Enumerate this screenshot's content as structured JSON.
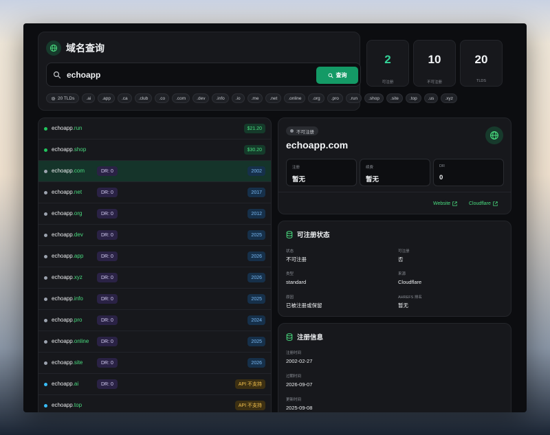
{
  "header": {
    "title": "域名查询",
    "search": {
      "value": "echoapp",
      "placeholder": ""
    },
    "query_button": "查询",
    "tld_count_label": "20 TLDs",
    "tlds": [
      ".ai",
      ".app",
      ".ca",
      ".club",
      ".co",
      ".com",
      ".dev",
      ".info",
      ".io",
      ".me",
      ".net",
      ".online",
      ".org",
      ".pro",
      ".run",
      ".shop",
      ".site",
      ".top",
      ".us",
      ".xyz"
    ]
  },
  "stats": [
    {
      "value": "2",
      "label": "可注册",
      "color": "#34d399"
    },
    {
      "value": "10",
      "label": "不可注册"
    },
    {
      "value": "20",
      "label": "TLDS"
    }
  ],
  "domains": [
    {
      "name": "echoapp",
      "tld": ".run",
      "dot": "#22c55e",
      "dr": "",
      "badge": "$21.20",
      "badge_type": "price"
    },
    {
      "name": "echoapp",
      "tld": ".shop",
      "dot": "#22c55e",
      "dr": "",
      "badge": "$30.20",
      "badge_type": "price"
    },
    {
      "name": "echoapp",
      "tld": ".com",
      "dot": "#9ca3af",
      "dr": "DR: 0",
      "badge": "2002",
      "badge_type": "year",
      "selected": true
    },
    {
      "name": "echoapp",
      "tld": ".net",
      "dot": "#9ca3af",
      "dr": "DR: 0",
      "badge": "2017",
      "badge_type": "year"
    },
    {
      "name": "echoapp",
      "tld": ".org",
      "dot": "#9ca3af",
      "dr": "DR: 0",
      "badge": "2012",
      "badge_type": "year"
    },
    {
      "name": "echoapp",
      "tld": ".dev",
      "dot": "#9ca3af",
      "dr": "DR: 0",
      "badge": "2025",
      "badge_type": "year"
    },
    {
      "name": "echoapp",
      "tld": ".app",
      "dot": "#9ca3af",
      "dr": "DR: 0",
      "badge": "2026",
      "badge_type": "year"
    },
    {
      "name": "echoapp",
      "tld": ".xyz",
      "dot": "#9ca3af",
      "dr": "DR: 0",
      "badge": "2026",
      "badge_type": "year"
    },
    {
      "name": "echoapp",
      "tld": ".info",
      "dot": "#9ca3af",
      "dr": "DR: 0",
      "badge": "2025",
      "badge_type": "year"
    },
    {
      "name": "echoapp",
      "tld": ".pro",
      "dot": "#9ca3af",
      "dr": "DR: 0",
      "badge": "2024",
      "badge_type": "year"
    },
    {
      "name": "echoapp",
      "tld": ".online",
      "dot": "#9ca3af",
      "dr": "DR: 0",
      "badge": "2025",
      "badge_type": "year"
    },
    {
      "name": "echoapp",
      "tld": ".site",
      "dot": "#9ca3af",
      "dr": "DR: 0",
      "badge": "2026",
      "badge_type": "year"
    },
    {
      "name": "echoapp",
      "tld": ".ai",
      "dot": "#38bdf8",
      "dr": "DR: 0",
      "badge": "API 不支持",
      "badge_type": "api"
    },
    {
      "name": "echoapp",
      "tld": ".top",
      "dot": "#38bdf8",
      "dr": "",
      "badge": "API 不支持",
      "badge_type": "api"
    }
  ],
  "detail": {
    "status": "不可注册",
    "domain": "echoapp.com",
    "boxes": [
      {
        "label": "注册",
        "value": "暂无"
      },
      {
        "label": "续费",
        "value": "暂无"
      },
      {
        "label": "DR",
        "value": "0"
      }
    ],
    "links": {
      "website": "Website",
      "cloudflare": "Cloudflare"
    }
  },
  "availability": {
    "title": "可注册状态",
    "fields": [
      {
        "label": "状态",
        "value": "不可注册"
      },
      {
        "label": "可注册",
        "value": "否"
      },
      {
        "label": "类型",
        "value": "standard"
      },
      {
        "label": "来源",
        "value": "Cloudflare"
      },
      {
        "label": "原因",
        "value": "已被注册或保留"
      },
      {
        "label": "AHREFS 排名",
        "value": "暂无"
      }
    ]
  },
  "registration": {
    "title": "注册信息",
    "fields": [
      {
        "label": "注册时间",
        "value": "2002-02-27"
      },
      {
        "label": "过期时间",
        "value": "2026-09-07"
      },
      {
        "label": "更新时间",
        "value": "2025-09-08"
      }
    ]
  },
  "colors": {
    "accent": "#149a66",
    "accent_text": "#4ade80",
    "background": "#0c0d10",
    "panel": "#17181c"
  }
}
